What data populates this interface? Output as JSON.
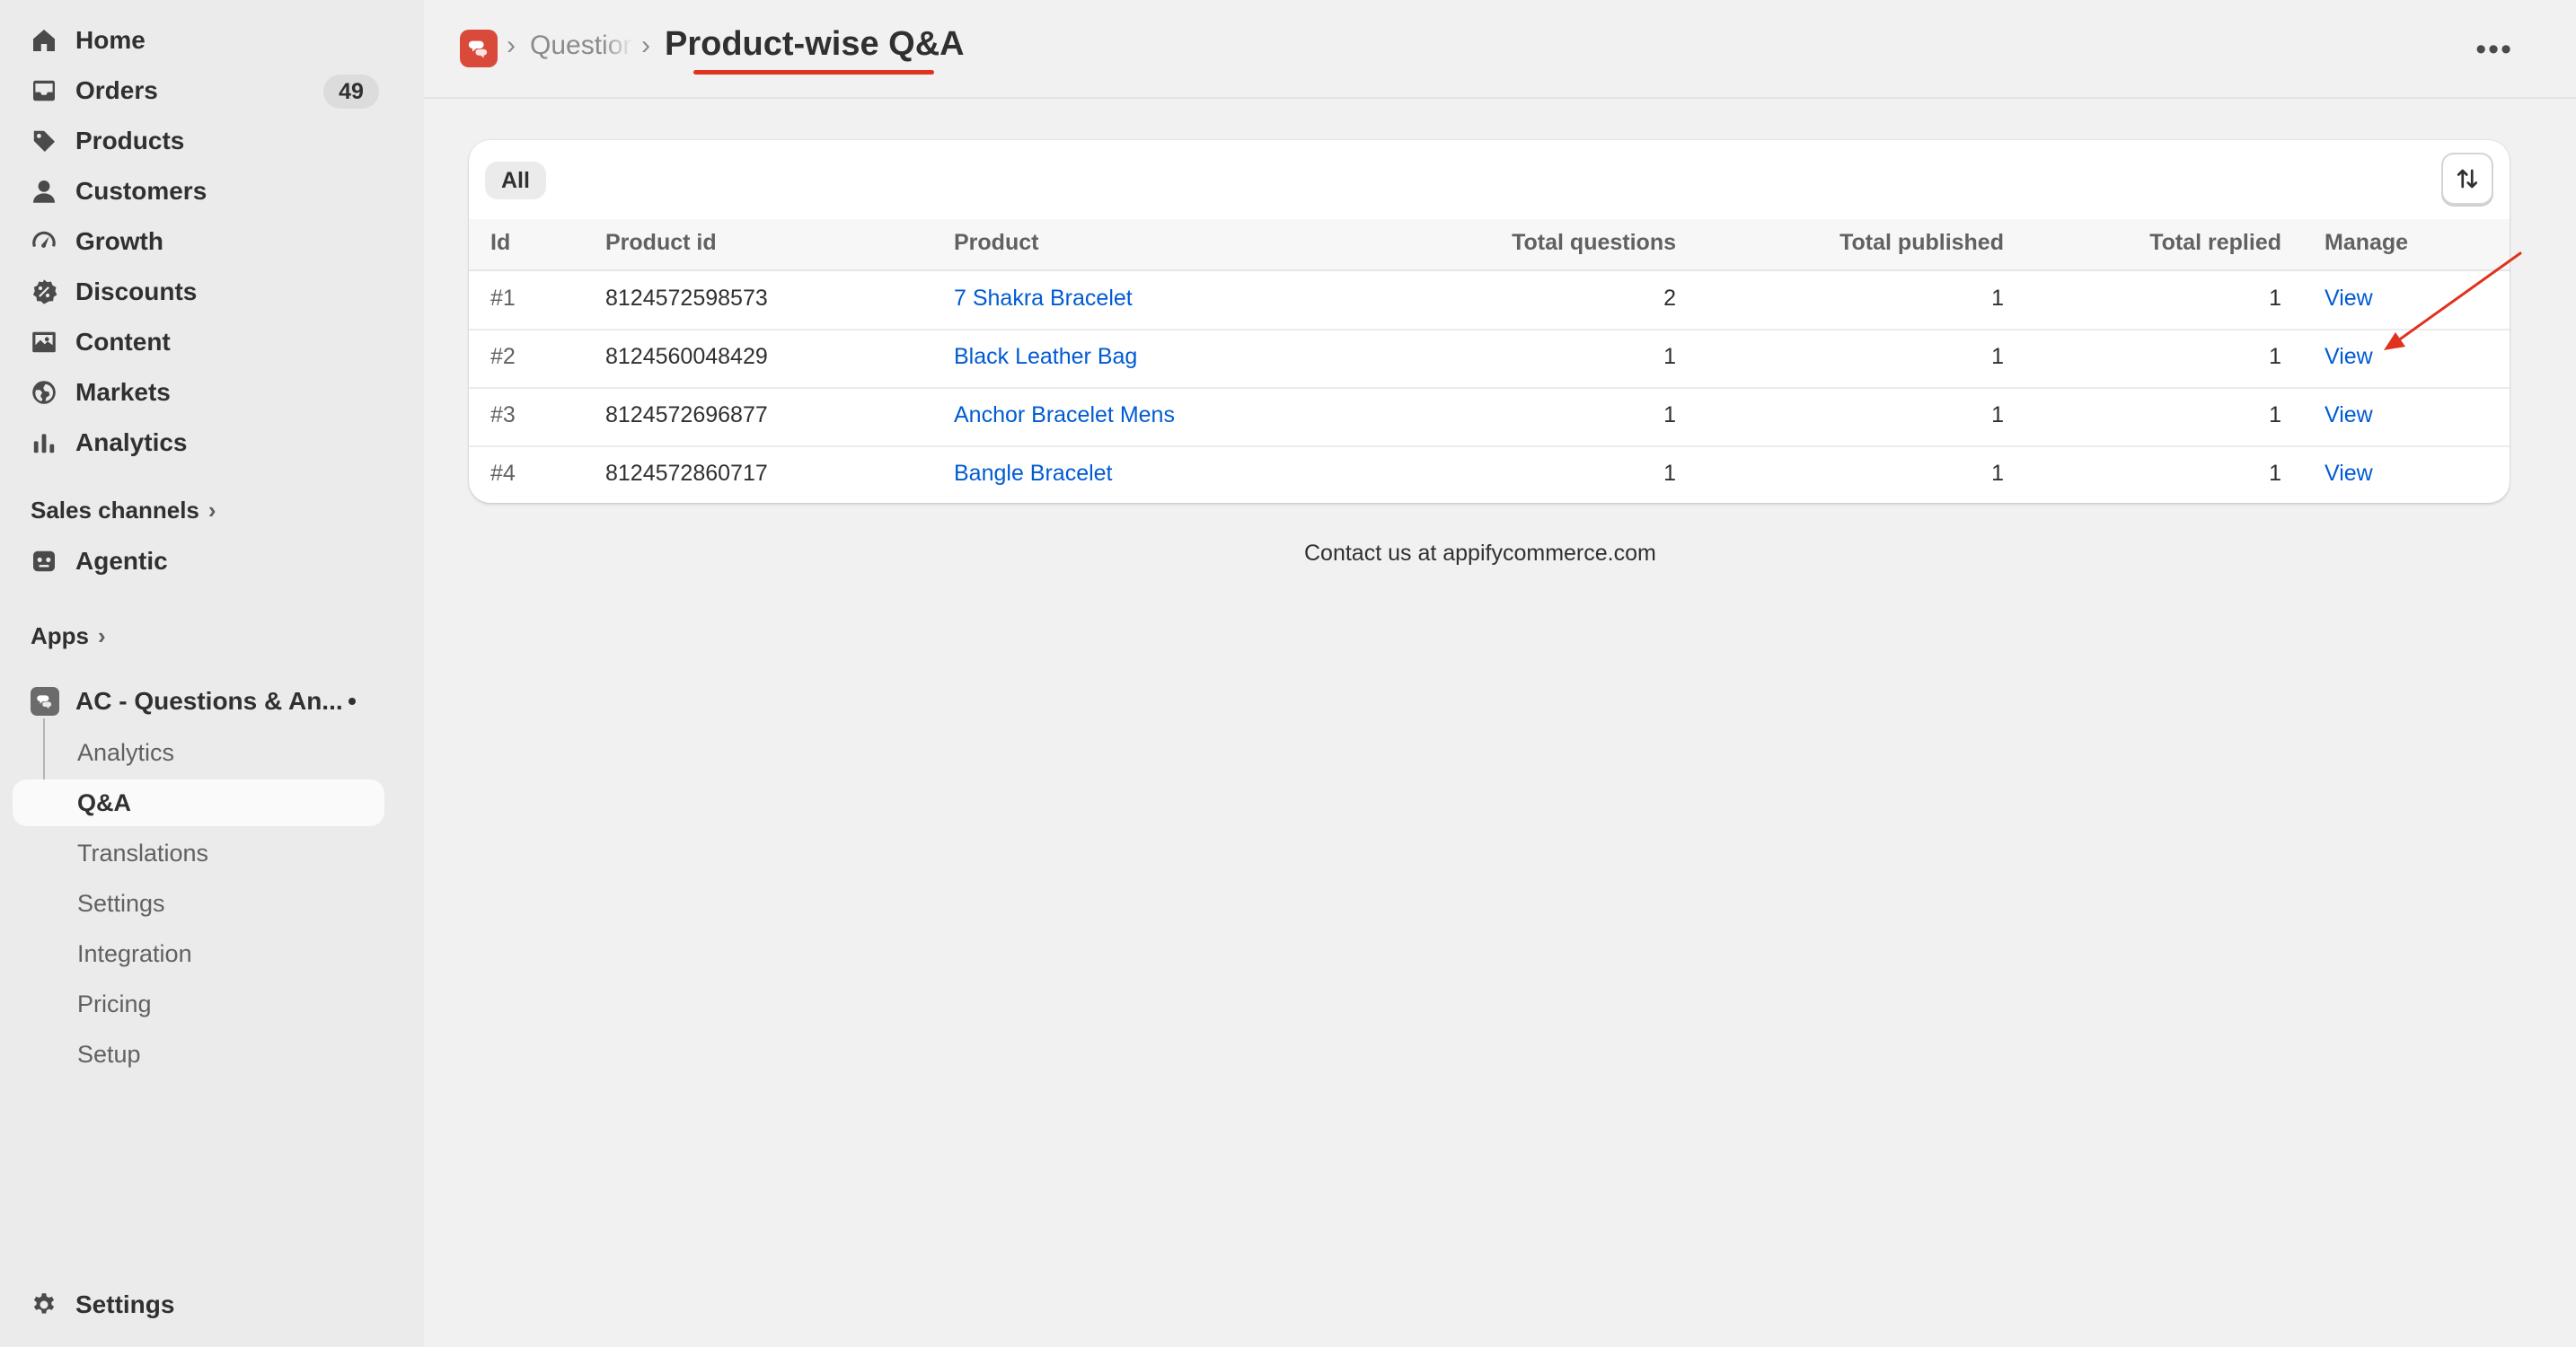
{
  "sidebar": {
    "nav": [
      {
        "label": "Home",
        "icon": "home-icon"
      },
      {
        "label": "Orders",
        "icon": "inbox-icon",
        "badge": "49"
      },
      {
        "label": "Products",
        "icon": "tag-icon"
      },
      {
        "label": "Customers",
        "icon": "person-icon"
      },
      {
        "label": "Growth",
        "icon": "gauge-icon"
      },
      {
        "label": "Discounts",
        "icon": "discount-icon"
      },
      {
        "label": "Content",
        "icon": "image-icon"
      },
      {
        "label": "Markets",
        "icon": "globe-icon"
      },
      {
        "label": "Analytics",
        "icon": "bar-chart-icon"
      }
    ],
    "sales_channels_label": "Sales channels",
    "agentic_label": "Agentic",
    "apps_label": "Apps",
    "app_name": "AC - Questions & An...",
    "app_sub": [
      "Analytics",
      "Q&A",
      "Translations",
      "Settings",
      "Integration",
      "Pricing",
      "Setup"
    ],
    "settings_label": "Settings"
  },
  "header": {
    "breadcrumb": "Questions & Answers",
    "title": "Product-wise Q&A"
  },
  "table": {
    "tab_all": "All",
    "columns": [
      "Id",
      "Product id",
      "Product",
      "Total questions",
      "Total published",
      "Total replied",
      "Manage"
    ],
    "rows": [
      {
        "id": "#1",
        "product_id": "8124572598573",
        "product": "7 Shakra Bracelet",
        "total_questions": "2",
        "total_published": "1",
        "total_replied": "1",
        "manage": "View"
      },
      {
        "id": "#2",
        "product_id": "8124560048429",
        "product": "Black Leather Bag",
        "total_questions": "1",
        "total_published": "1",
        "total_replied": "1",
        "manage": "View"
      },
      {
        "id": "#3",
        "product_id": "8124572696877",
        "product": "Anchor Bracelet Mens",
        "total_questions": "1",
        "total_published": "1",
        "total_replied": "1",
        "manage": "View"
      },
      {
        "id": "#4",
        "product_id": "8124572860717",
        "product": "Bangle Bracelet",
        "total_questions": "1",
        "total_published": "1",
        "total_replied": "1",
        "manage": "View"
      }
    ]
  },
  "footer": {
    "contact": "Contact us at appifycommerce.com"
  },
  "colors": {
    "accent_link": "#005bd3",
    "annotation": "#e0321d",
    "app_icon": "#d94a3b"
  }
}
